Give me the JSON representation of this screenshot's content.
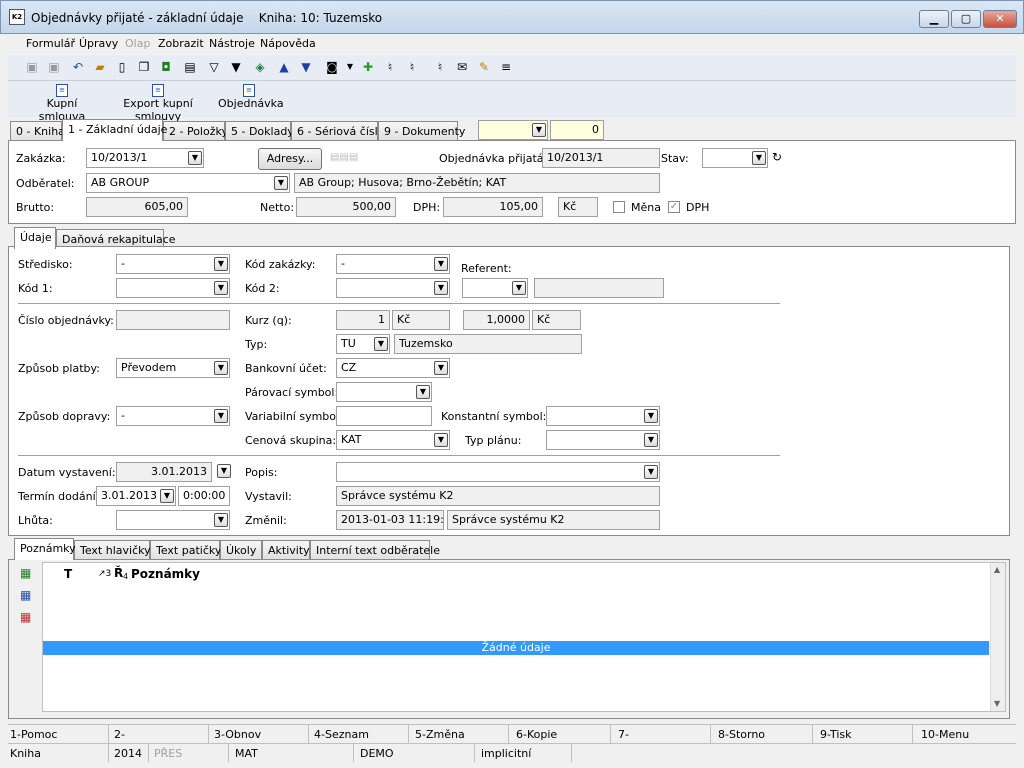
{
  "window": {
    "title": "Objednávky přijaté - základní údaje    Kniha: 10: Tuzemsko",
    "app_icon": "K2"
  },
  "menu": [
    "Formulář",
    "Úpravy",
    "Olap",
    "Zobrazit",
    "Nástroje",
    "Nápověda"
  ],
  "big_buttons": [
    "Kupní smlouva",
    "Export kupní smlouvy",
    "Objednávka"
  ],
  "main_tabs": [
    "0 - Kniha",
    "1 - Základní údaje",
    "2 - Položky",
    "5 - Doklady",
    "6 - Sériová čísla",
    "9 - Dokumenty"
  ],
  "top_counter": "0",
  "header": {
    "zakazka_label": "Zakázka:",
    "zakazka": "10/2013/1",
    "adresy_button": "Adresy...",
    "obj_label": "Objednávka přijatá:",
    "obj": "10/2013/1",
    "stav_label": "Stav:",
    "odberatel_label": "Odběratel:",
    "odberatel": "AB GROUP",
    "odberatel_addr": "AB Group; Husova; Brno-Žebětín; KAT",
    "brutto_label": "Brutto:",
    "brutto": "605,00",
    "netto_label": "Netto:",
    "netto": "500,00",
    "dph_label": "DPH:",
    "dph": "105,00",
    "currency": "Kč",
    "mena_label": "Měna",
    "dph_chk_label": "DPH"
  },
  "inner_tabs": [
    "Údaje",
    "Daňová rekapitulace"
  ],
  "form": {
    "stredisko_label": "Středisko:",
    "stredisko": "-",
    "kod_zakazky_label": "Kód zakázky:",
    "kod_zakazky": "-",
    "referent_label": "Referent:",
    "kod1_label": "Kód 1:",
    "kod2_label": "Kód 2:",
    "cislo_obj_label": "Číslo objednávky:",
    "kurz_label": "Kurz (q):",
    "kurz_amount": "1",
    "kurz_cur1": "Kč",
    "kurz_rate": "1,0000",
    "kurz_cur2": "Kč",
    "typ_label": "Typ:",
    "typ_code": "TU",
    "typ_name": "Tuzemsko",
    "zpusob_platby_label": "Způsob platby:",
    "zpusob_platby": "Převodem",
    "bank_label": "Bankovní účet:",
    "bank": "CZ",
    "parovaci_label": "Párovací symbol:",
    "zpusob_dopravy_label": "Způsob dopravy:",
    "zpusob_dopravy": "-",
    "vs_label": "Variabilní symbol:",
    "ks_label": "Konstantní symbol:",
    "cenova_label": "Cenová skupina:",
    "cenova": "KAT",
    "typ_planu_label": "Typ plánu:",
    "datum_vyst_label": "Datum vystavení:",
    "datum_vyst": "3.01.2013",
    "popis_label": "Popis:",
    "termin_label": "Termín dodání:",
    "termin_date": "3.01.2013",
    "termin_time": "0:00:00",
    "vystavil_label": "Vystavil:",
    "vystavil": "Správce systému K2",
    "lhuta_label": "Lhůta:",
    "zmenil_label": "Změnil:",
    "zmenil_date": "2013-01-03 11:19:55",
    "zmenil_user": "Správce systému K2"
  },
  "bottom_tabs": [
    "Poznámky",
    "Text hlavičky",
    "Text patičky",
    "Úkoly",
    "Aktivity",
    "Interní text odběratele"
  ],
  "grid": {
    "col_t": "T",
    "col_sort": "↗3",
    "col_r": "Ř",
    "col_sub": "4",
    "col_name": "Poznámky",
    "empty": "Žádné údaje"
  },
  "fkeys": [
    "1-Pomoc",
    "2-",
    "3-Obnov",
    "4-Seznam",
    "5-Změna",
    "6-Kopie",
    "7-",
    "8-Storno",
    "9-Tisk",
    "10-Menu"
  ],
  "status": {
    "kniha": "Kniha",
    "year": "2014",
    "pres": "PŘES",
    "mat": "MAT",
    "demo": "DEMO",
    "impl": "implicitní"
  },
  "colors": {
    "selection": "#3399ff",
    "yellow_field": "#ffffe0"
  }
}
